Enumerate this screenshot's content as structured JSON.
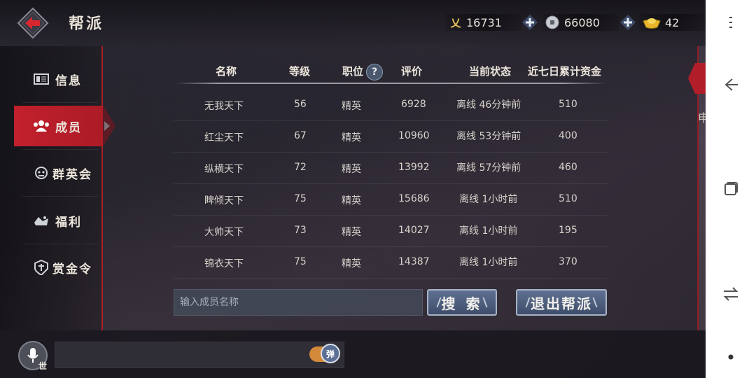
{
  "header": {
    "title": "帮派",
    "currencies": [
      {
        "icon": "yi-currency-icon",
        "value": "16731"
      },
      {
        "icon": "coin-icon",
        "value": "66080"
      },
      {
        "icon": "gold-ingot-icon",
        "value": "42"
      }
    ]
  },
  "sidebar": {
    "items": [
      {
        "label": "信息",
        "icon": "info-icon",
        "active": false
      },
      {
        "label": "成员",
        "icon": "members-icon",
        "active": true
      },
      {
        "label": "群英会",
        "icon": "heroes-icon",
        "active": false
      },
      {
        "label": "福利",
        "icon": "welfare-icon",
        "active": false
      },
      {
        "label": "赏金令",
        "icon": "bounty-icon",
        "active": false
      }
    ]
  },
  "table": {
    "headers": [
      "名称",
      "等级",
      "职位",
      "评价",
      "当前状态",
      "近七日累计资金"
    ],
    "help_label": "?",
    "rows": [
      {
        "name": "无我天下",
        "level": "56",
        "position": "精英",
        "rating": "6928",
        "status": "离线 46分钟前",
        "funds": "510"
      },
      {
        "name": "红尘天下",
        "level": "67",
        "position": "精英",
        "rating": "10960",
        "status": "离线 53分钟前",
        "funds": "400"
      },
      {
        "name": "纵横天下",
        "level": "72",
        "position": "精英",
        "rating": "13992",
        "status": "离线 57分钟前",
        "funds": "460"
      },
      {
        "name": "睥倾天下",
        "level": "75",
        "position": "精英",
        "rating": "15686",
        "status": "离线 1小时前",
        "funds": "510"
      },
      {
        "name": "大帅天下",
        "level": "73",
        "position": "精英",
        "rating": "14027",
        "status": "离线 1小时前",
        "funds": "195"
      },
      {
        "name": "锦衣天下",
        "level": "75",
        "position": "精英",
        "rating": "14387",
        "status": "离线 1小时前",
        "funds": "370"
      }
    ]
  },
  "search": {
    "placeholder": "输入成员名称",
    "button_label": "搜 索"
  },
  "quit_button_label": "退出帮派",
  "right_panel_char": "申",
  "chat": {
    "channel_tag": "世",
    "toggle_label": "弹"
  },
  "colors": {
    "accent_red": "#c2202c",
    "button_blue": "#4a5a7a"
  }
}
